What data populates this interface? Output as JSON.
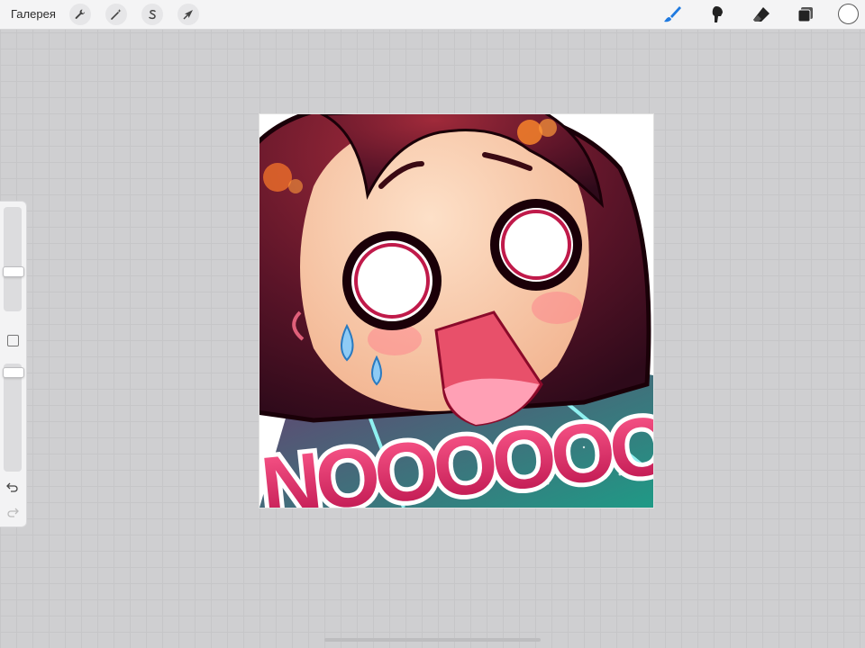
{
  "toolbar": {
    "gallery_label": "Галерея",
    "left_tools": [
      "wrench-icon",
      "magic-wand-icon",
      "selection-s-icon",
      "transform-arrow-icon"
    ],
    "right_tools": [
      "brush-icon",
      "smudge-icon",
      "eraser-icon",
      "layers-icon"
    ],
    "active_tool": "brush-icon",
    "accent_color": "#1f7ae0",
    "current_color": "#ffffff"
  },
  "sidebar": {
    "brush_size_level": 0.62,
    "opacity_level": 0.9,
    "tools": [
      "modifier-square-icon",
      "undo-icon",
      "redo-icon"
    ]
  },
  "canvas": {
    "artwork_text": "NOOOOOO",
    "colors": {
      "hair": "#6b1a2a",
      "skin": "#f6c2a2",
      "text_fill": "#d81b5c",
      "background": "#2c8f8a"
    }
  }
}
